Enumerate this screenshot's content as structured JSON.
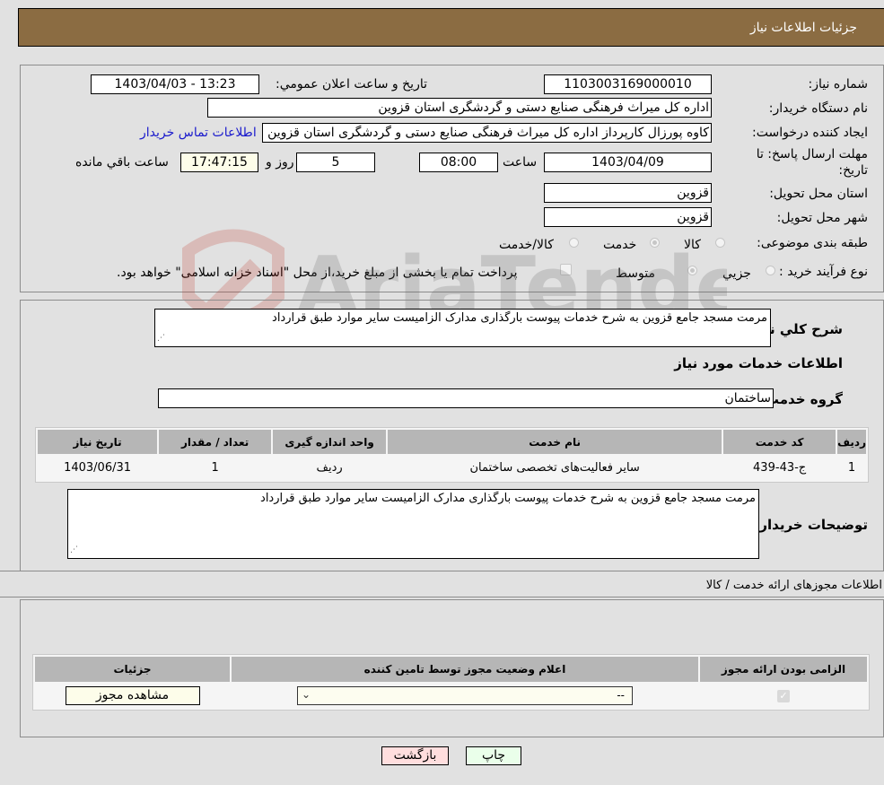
{
  "header": {
    "title": "جزئیات اطلاعات نیاز"
  },
  "form": {
    "need_number_label": "شماره نیاز:",
    "need_number": "1103003169000010",
    "announce_label": "تاریخ و ساعت اعلان عمومي:",
    "announce_value": "1403/04/03 - 13:23",
    "buyer_org_label": "نام دستگاه خریدار:",
    "buyer_org": "اداره کل میراث فرهنگی  صنایع دستی و گردشگری استان قزوین",
    "creator_label": "ایجاد کننده درخواست:",
    "creator": "کاوه پورزال کارپرداز اداره کل میراث فرهنگی  صنایع دستی و گردشگری استان قزوین",
    "contact_link": "اطلاعات تماس خریدار",
    "deadline_label": "مهلت ارسال پاسخ: تا تاریخ:",
    "deadline_date": "1403/04/09",
    "time_label": "ساعت",
    "deadline_time": "08:00",
    "days_remaining": "5",
    "days_label": "روز و",
    "time_remaining": "17:47:15",
    "remaining_label": "ساعت باقي مانده",
    "province_label": "استان محل تحویل:",
    "province": "قزوین",
    "city_label": "شهر محل تحویل:",
    "city": "قزوین",
    "category_label": "طبقه بندی موضوعی:",
    "category_options": [
      {
        "label": "کالا",
        "selected": false
      },
      {
        "label": "خدمت",
        "selected": true
      },
      {
        "label": "کالا/خدمت",
        "selected": false
      }
    ],
    "process_label": "نوع فرآیند خرید :",
    "process_options": [
      {
        "label": "جزیي",
        "selected": false
      },
      {
        "label": "متوسط",
        "selected": true
      }
    ],
    "treasury_checkbox_checked": false,
    "treasury_text": "پرداخت تمام یا بخشی از مبلغ خرید،از محل \"اسناد خزانه اسلامی\" خواهد بود."
  },
  "description": {
    "label": "شرح کلي نیاز:",
    "value": "مرمت مسجد جامع قزوین به شرح خدمات پیوست بارگذاری مدارک الزامیست سایر موارد طبق قرارداد"
  },
  "services": {
    "section_title": "اطلاعات خدمات مورد نیاز",
    "group_label": "گروه خدمت:",
    "group_value": "ساختمان",
    "table": {
      "headers": [
        "ردیف",
        "کد خدمت",
        "نام خدمت",
        "واحد اندازه گیری",
        "تعداد / مقدار",
        "تاریخ نیاز"
      ],
      "rows": [
        [
          "1",
          "ج-43-439",
          "سایر فعالیت‌های تخصصی ساختمان",
          "ردیف",
          "1",
          "1403/06/31"
        ]
      ]
    }
  },
  "buyer_notes": {
    "label": "توضیحات خریدار:",
    "value": "مرمت مسجد جامع قزوین به شرح خدمات پیوست بارگذاری مدارک الزامیست سایر موارد طبق قرارداد"
  },
  "permits": {
    "section_title": "اطلاعات مجوزهای ارائه خدمت / کالا",
    "headers": [
      "الزامی بودن ارائه مجوز",
      "اعلام وضعیت مجوز توسط تامین کننده",
      "جزئیات"
    ],
    "row": {
      "required_checked": true,
      "status_selected": "--",
      "details_button": "مشاهده مجوز"
    }
  },
  "actions": {
    "print": "چاپ",
    "back": "بازگشت"
  },
  "colors": {
    "header_bg": "#8b6c42",
    "print_bg": "#eaffea",
    "back_bg": "#ffdede",
    "link": "#1a1acc"
  }
}
